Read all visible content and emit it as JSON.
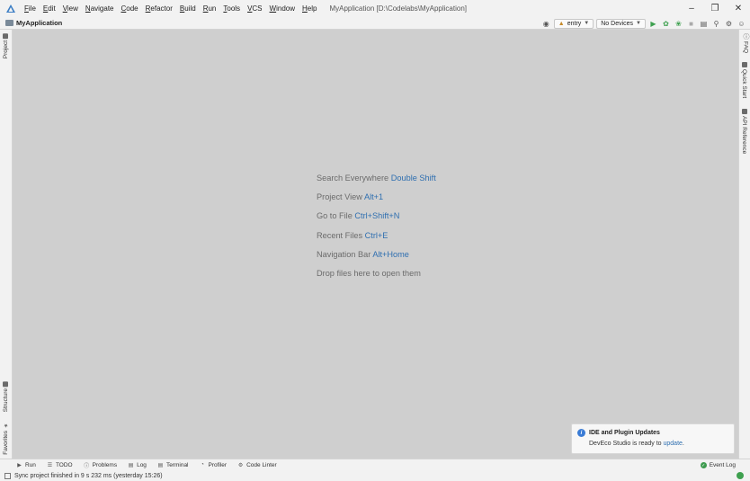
{
  "menu": {
    "items": [
      "File",
      "Edit",
      "View",
      "Navigate",
      "Code",
      "Refactor",
      "Build",
      "Run",
      "Tools",
      "VCS",
      "Window",
      "Help"
    ],
    "window_title": "MyApplication [D:\\Codelabs\\MyApplication]"
  },
  "navbar": {
    "project": "MyApplication",
    "run_config": "entry",
    "device": "No Devices"
  },
  "left_tabs": {
    "project": "Project",
    "structure": "Structure",
    "favorites": "Favorites"
  },
  "right_tabs": {
    "faq": "FAQ",
    "quick_start": "Quick Start",
    "api_reference": "API Reference"
  },
  "hints": [
    {
      "text": "Search Everywhere",
      "key": "Double Shift"
    },
    {
      "text": "Project View",
      "key": "Alt+1"
    },
    {
      "text": "Go to File",
      "key": "Ctrl+Shift+N"
    },
    {
      "text": "Recent Files",
      "key": "Ctrl+E"
    },
    {
      "text": "Navigation Bar",
      "key": "Alt+Home"
    },
    {
      "text": "Drop files here to open them",
      "key": ""
    }
  ],
  "notification": {
    "title": "IDE and Plugin Updates",
    "body": "DevEco Studio is ready to",
    "link": "update",
    "after": "."
  },
  "bottom_tools": [
    "Run",
    "TODO",
    "Problems",
    "Log",
    "Terminal",
    "Profiler",
    "Code Linter"
  ],
  "event_log": "Event Log",
  "status": "Sync project finished in 9 s 232 ms (yesterday 15:26)",
  "colors": {
    "link": "#2f6fb0",
    "run_green": "#3ea04f",
    "editor_bg": "#cfcfcf"
  }
}
